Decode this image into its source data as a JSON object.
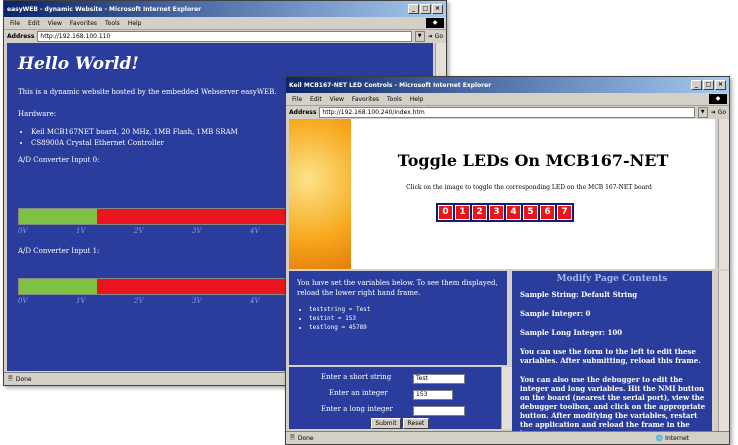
{
  "win1": {
    "title": "easyWEB - dynamic Website - Microsoft Internet Explorer",
    "menu": [
      "File",
      "Edit",
      "View",
      "Favorites",
      "Tools",
      "Help"
    ],
    "address_label": "Address",
    "address": "http://192.168.100.110",
    "go": "Go",
    "heading": "Hello World!",
    "intro": "This is a dynamic website hosted by the embedded Webserver easyWEB.",
    "hardware_label": "Hardware:",
    "hardware": [
      "Keil MCB167NET board, 20 MHz, 1MB Flash, 1MB SRAM",
      "CS8900A Crystal Ethernet Controller"
    ],
    "adc0_label": "A/D Converter Input 0:",
    "adc0_level": 0.19,
    "adc1_label": "A/D Converter Input 1:",
    "adc1_level": 0.19,
    "ticks": [
      "0V",
      "1V",
      "2V",
      "3V",
      "4V"
    ],
    "status": "Done"
  },
  "win2": {
    "title": "Keil MCB167-NET LED Controls - Microsoft Internet Explorer",
    "menu": [
      "File",
      "Edit",
      "View",
      "Favorites",
      "Tools",
      "Help"
    ],
    "address_label": "Address",
    "address": "http://192.168.100.240/index.htm",
    "go": "Go",
    "heading": "Toggle LEDs On MCB167-NET",
    "subtitle": "Click on the image to toggle the corresponding LED on the MCB 167-NET board",
    "leds": [
      "0",
      "1",
      "2",
      "3",
      "4",
      "5",
      "6",
      "7"
    ],
    "vars_text": "You have set the variables below. To see them displayed, reload the lower right hand frame.",
    "vars": [
      "teststring = Test",
      "testint = 153",
      "testlong = 45789"
    ],
    "form": {
      "short_label": "Enter a short string",
      "short_value": "Test",
      "int_label": "Enter an integer",
      "int_value": "153",
      "long_label": "Enter a long integer",
      "long_value": "",
      "submit": "Submit",
      "reset": "Reset"
    },
    "modify": {
      "heading": "Modify Page Contents",
      "sample_string": "Sample String: Default String",
      "sample_int": "Sample Integer: 0",
      "sample_long": "Sample Long Integer: 100",
      "p1": "You can use the form to the left to edit these variables. After submitting, reload this frame.",
      "p2": "You can also use the debugger to edit the integer and long variables. Hit the NMI button on the board (nearest the serial port), view the debugger toolbox, and click on the appropriate button. After modifying the variables, restart the application and reload the frame in the browser."
    },
    "status": "Done",
    "zone": "Internet"
  }
}
